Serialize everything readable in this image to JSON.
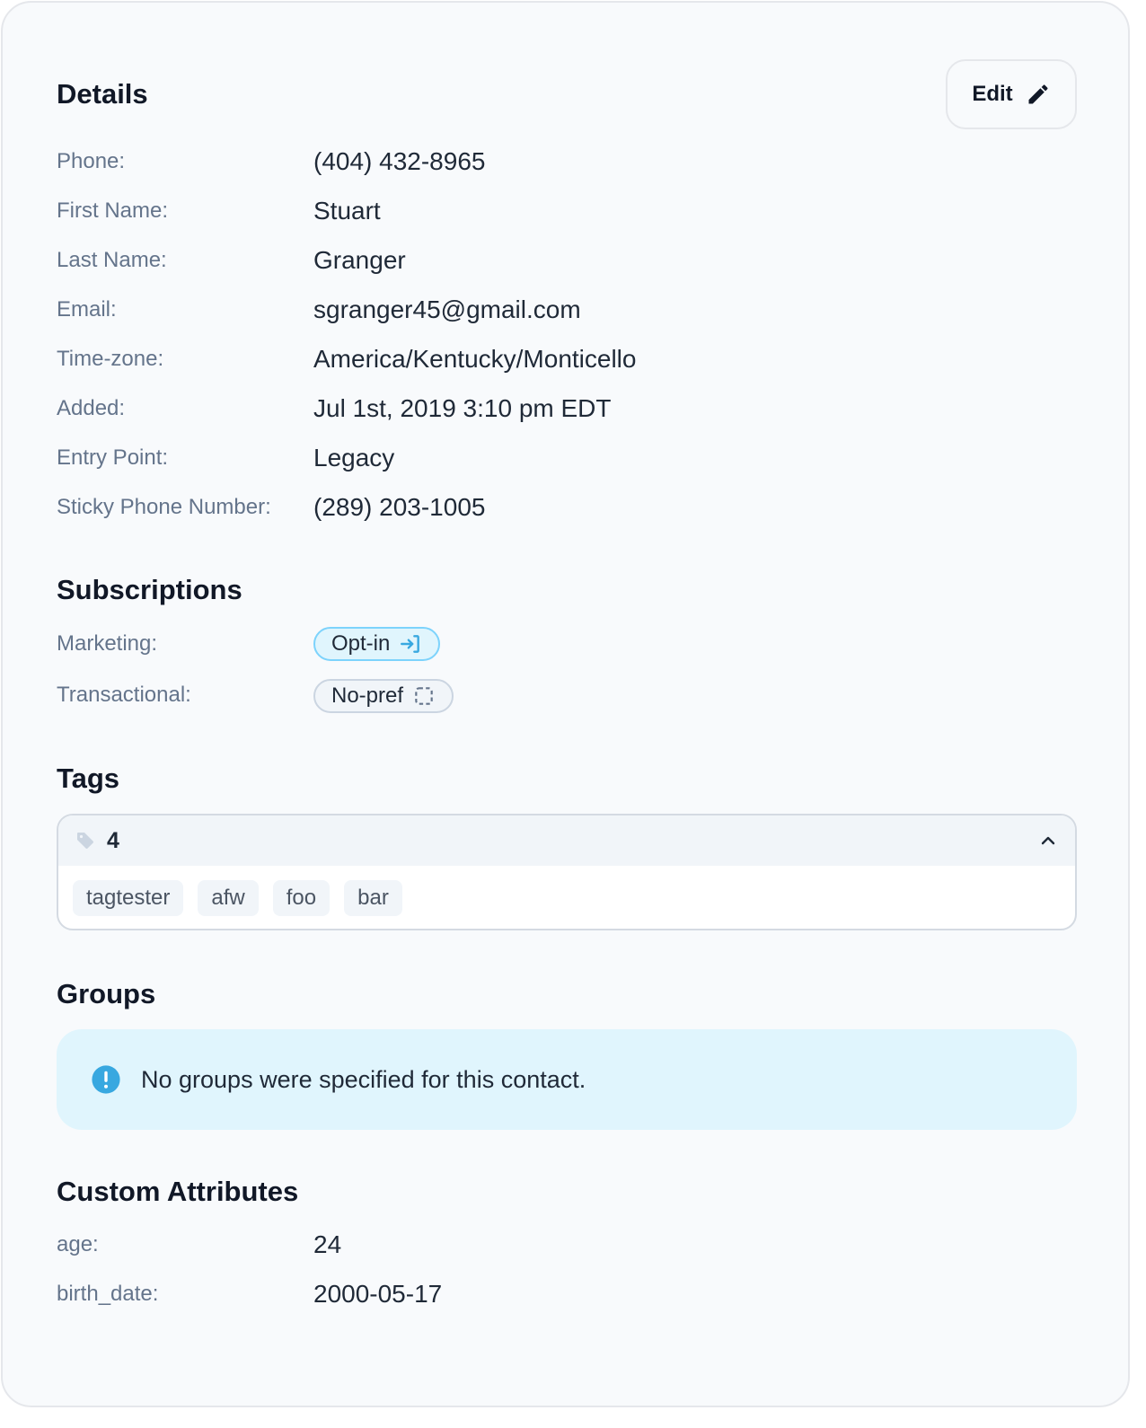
{
  "details": {
    "title": "Details",
    "edit_label": "Edit",
    "rows": [
      {
        "label": "Phone:",
        "value": "(404) 432-8965"
      },
      {
        "label": "First Name:",
        "value": "Stuart"
      },
      {
        "label": "Last Name:",
        "value": "Granger"
      },
      {
        "label": "Email:",
        "value": "sgranger45@gmail.com"
      },
      {
        "label": "Time-zone:",
        "value": "America/Kentucky/Monticello"
      },
      {
        "label": "Added:",
        "value": "Jul 1st, 2019 3:10 pm EDT"
      },
      {
        "label": "Entry Point:",
        "value": "Legacy"
      },
      {
        "label": "Sticky Phone Number:",
        "value": "(289) 203-1005"
      }
    ]
  },
  "subscriptions": {
    "title": "Subscriptions",
    "marketing_label": "Marketing:",
    "marketing_value": "Opt-in",
    "transactional_label": "Transactional:",
    "transactional_value": "No-pref"
  },
  "tags": {
    "title": "Tags",
    "count": "4",
    "items": [
      "tagtester",
      "afw",
      "foo",
      "bar"
    ]
  },
  "groups": {
    "title": "Groups",
    "empty_message": "No groups were specified for this contact."
  },
  "custom_attributes": {
    "title": "Custom Attributes",
    "rows": [
      {
        "label": "age:",
        "value": "24"
      },
      {
        "label": "birth_date:",
        "value": "2000-05-17"
      }
    ]
  },
  "colors": {
    "background": "#f8fafc",
    "optin_bg": "#e0f5fd",
    "optin_border": "#7dd3fc",
    "info_icon": "#38a8e0",
    "label_gray": "#64748b"
  }
}
